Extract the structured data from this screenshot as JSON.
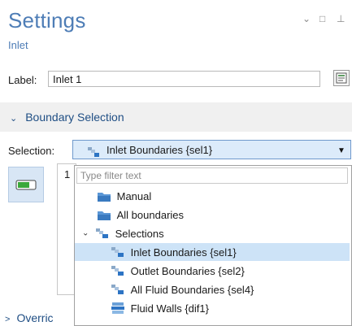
{
  "header": {
    "title": "Settings",
    "subtitle": "Inlet"
  },
  "window_controls": {
    "chevron": "⌄",
    "restore": "□",
    "pin": "⊥"
  },
  "label_field": {
    "label": "Label:",
    "value": "Inlet 1"
  },
  "boundary_section": {
    "title": "Boundary Selection"
  },
  "selection": {
    "label": "Selection:",
    "current": "Inlet Boundaries {sel1}",
    "list_first_entry": "1"
  },
  "dropdown_popup": {
    "filter_placeholder": "Type filter text",
    "items": [
      {
        "label": "Manual",
        "icon": "folder-icon",
        "level": 1,
        "selected": false
      },
      {
        "label": "All boundaries",
        "icon": "folder-icon",
        "level": 1,
        "selected": false
      },
      {
        "label": "Selections",
        "icon": "selections-icon",
        "level": 0,
        "expanded": true,
        "selected": false
      },
      {
        "label": "Inlet Boundaries {sel1}",
        "icon": "selection-node-icon",
        "level": 2,
        "selected": true
      },
      {
        "label": "Outlet Boundaries {sel2}",
        "icon": "selection-node-icon",
        "level": 2,
        "selected": false
      },
      {
        "label": "All Fluid Boundaries {sel4}",
        "icon": "selection-node-icon",
        "level": 2,
        "selected": false
      },
      {
        "label": "Fluid Walls {dif1}",
        "icon": "difference-icon",
        "level": 2,
        "selected": false
      }
    ]
  },
  "override_section": {
    "title": "Overric"
  }
}
